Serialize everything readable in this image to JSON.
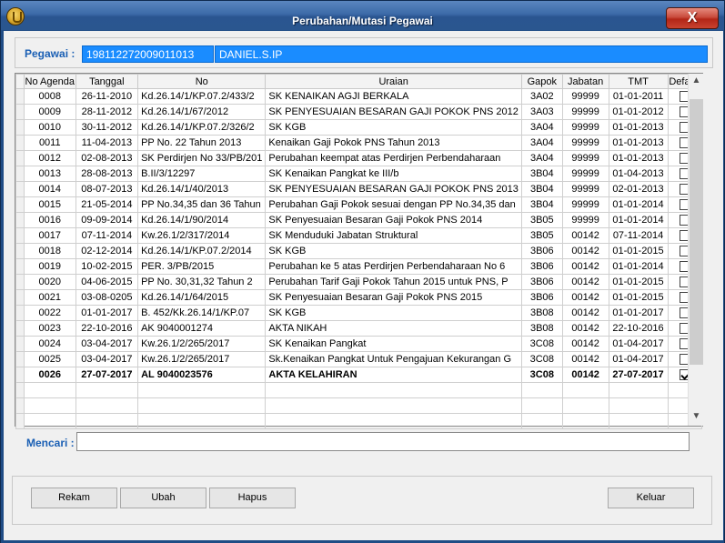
{
  "window": {
    "title": "Perubahan/Mutasi Pegawai",
    "close_label": "X"
  },
  "pegawai": {
    "label": "Pegawai :",
    "nip": "198112272009011013",
    "nama": "DANIEL.S.IP"
  },
  "grid": {
    "columns": [
      "No Agenda",
      "Tanggal",
      "No",
      "Uraian",
      "Gapok",
      "Jabatan",
      "TMT",
      "Default"
    ],
    "rows": [
      {
        "no_agenda": "0008",
        "tanggal": "26-11-2010",
        "no": "Kd.26.14/1/KP.07.2/433/2",
        "uraian": "SK KENAIKAN AGJI BERKALA",
        "gapok": "3A02",
        "jabatan": "99999",
        "tmt": "01-01-2011",
        "default": false
      },
      {
        "no_agenda": "0009",
        "tanggal": "28-11-2012",
        "no": "Kd.26.14/1/67/2012",
        "uraian": "SK PENYESUAIAN BESARAN GAJI POKOK PNS 2012",
        "gapok": "3A03",
        "jabatan": "99999",
        "tmt": "01-01-2012",
        "default": false
      },
      {
        "no_agenda": "0010",
        "tanggal": "30-11-2012",
        "no": "Kd.26.14/1/KP.07.2/326/2",
        "uraian": "SK KGB",
        "gapok": "3A04",
        "jabatan": "99999",
        "tmt": "01-01-2013",
        "default": false
      },
      {
        "no_agenda": "0011",
        "tanggal": "11-04-2013",
        "no": "PP No. 22 Tahun 2013",
        "uraian": "Kenaikan Gaji Pokok PNS Tahun 2013",
        "gapok": "3A04",
        "jabatan": "99999",
        "tmt": "01-01-2013",
        "default": false
      },
      {
        "no_agenda": "0012",
        "tanggal": "02-08-2013",
        "no": "SK Perdirjen No 33/PB/201",
        "uraian": "Perubahan keempat atas Perdirjen Perbendaharaan",
        "gapok": "3A04",
        "jabatan": "99999",
        "tmt": "01-01-2013",
        "default": false
      },
      {
        "no_agenda": "0013",
        "tanggal": "28-08-2013",
        "no": "B.II/3/12297",
        "uraian": "SK Kenaikan Pangkat ke III/b",
        "gapok": "3B04",
        "jabatan": "99999",
        "tmt": "01-04-2013",
        "default": false
      },
      {
        "no_agenda": "0014",
        "tanggal": "08-07-2013",
        "no": "Kd.26.14/1/40/2013",
        "uraian": "SK PENYESUAIAN BESARAN GAJI POKOK PNS 2013",
        "gapok": "3B04",
        "jabatan": "99999",
        "tmt": "02-01-2013",
        "default": false
      },
      {
        "no_agenda": "0015",
        "tanggal": "21-05-2014",
        "no": "PP No.34,35 dan 36 Tahun",
        "uraian": "Perubahan Gaji Pokok sesuai dengan PP No.34,35 dan",
        "gapok": "3B04",
        "jabatan": "99999",
        "tmt": "01-01-2014",
        "default": false
      },
      {
        "no_agenda": "0016",
        "tanggal": "09-09-2014",
        "no": "Kd.26.14/1/90/2014",
        "uraian": "SK Penyesuaian Besaran Gaji Pokok PNS 2014",
        "gapok": "3B05",
        "jabatan": "99999",
        "tmt": "01-01-2014",
        "default": false
      },
      {
        "no_agenda": "0017",
        "tanggal": "07-11-2014",
        "no": "Kw.26.1/2/317/2014",
        "uraian": "SK Menduduki Jabatan Struktural",
        "gapok": "3B05",
        "jabatan": "00142",
        "tmt": "07-11-2014",
        "default": false
      },
      {
        "no_agenda": "0018",
        "tanggal": "02-12-2014",
        "no": "Kd.26.14/1/KP.07.2/2014",
        "uraian": "SK KGB",
        "gapok": "3B06",
        "jabatan": "00142",
        "tmt": "01-01-2015",
        "default": false
      },
      {
        "no_agenda": "0019",
        "tanggal": "10-02-2015",
        "no": "PER. 3/PB/2015",
        "uraian": "Perubahan ke 5 atas Perdirjen Perbendaharaan No 6",
        "gapok": "3B06",
        "jabatan": "00142",
        "tmt": "01-01-2014",
        "default": false
      },
      {
        "no_agenda": "0020",
        "tanggal": "04-06-2015",
        "no": "PP No. 30,31,32 Tahun 2",
        "uraian": "Perubahan Tarif Gaji Pokok Tahun 2015 untuk PNS, P",
        "gapok": "3B06",
        "jabatan": "00142",
        "tmt": "01-01-2015",
        "default": false
      },
      {
        "no_agenda": "0021",
        "tanggal": "03-08-0205",
        "no": "Kd.26.14/1/64/2015",
        "uraian": "SK Penyesuaian Besaran Gaji Pokok PNS 2015",
        "gapok": "3B06",
        "jabatan": "00142",
        "tmt": "01-01-2015",
        "default": false
      },
      {
        "no_agenda": "0022",
        "tanggal": "01-01-2017",
        "no": "B. 452/Kk.26.14/1/KP.07",
        "uraian": "SK KGB",
        "gapok": "3B08",
        "jabatan": "00142",
        "tmt": "01-01-2017",
        "default": false
      },
      {
        "no_agenda": "0023",
        "tanggal": "22-10-2016",
        "no": "AK 9040001274",
        "uraian": "AKTA NIKAH",
        "gapok": "3B08",
        "jabatan": "00142",
        "tmt": "22-10-2016",
        "default": false
      },
      {
        "no_agenda": "0024",
        "tanggal": "03-04-2017",
        "no": "Kw.26.1/2/265/2017",
        "uraian": "SK Kenaikan Pangkat",
        "gapok": "3C08",
        "jabatan": "00142",
        "tmt": "01-04-2017",
        "default": false
      },
      {
        "no_agenda": "0025",
        "tanggal": "03-04-2017",
        "no": "Kw.26.1/2/265/2017",
        "uraian": "Sk.Kenaikan Pangkat Untuk Pengajuan Kekurangan G",
        "gapok": "3C08",
        "jabatan": "00142",
        "tmt": "01-04-2017",
        "default": false
      },
      {
        "no_agenda": "0026",
        "tanggal": "27-07-2017",
        "no": "AL 9040023576",
        "uraian": "AKTA KELAHIRAN",
        "gapok": "3C08",
        "jabatan": "00142",
        "tmt": "27-07-2017",
        "default": true
      }
    ]
  },
  "search": {
    "label": "Mencari :",
    "value": ""
  },
  "buttons": {
    "rekam": "Rekam",
    "ubah": "Ubah",
    "hapus": "Hapus",
    "keluar": "Keluar"
  },
  "icons": {
    "app": "coin-emblem-icon",
    "close": "close-icon",
    "scroll_up": "chevron-up-icon",
    "scroll_down": "chevron-down-icon"
  },
  "colors": {
    "title_bar": "#2a5590",
    "field_blue": "#1a8cff",
    "label_blue": "#1a5fb4",
    "close_red": "#c94b3c"
  }
}
